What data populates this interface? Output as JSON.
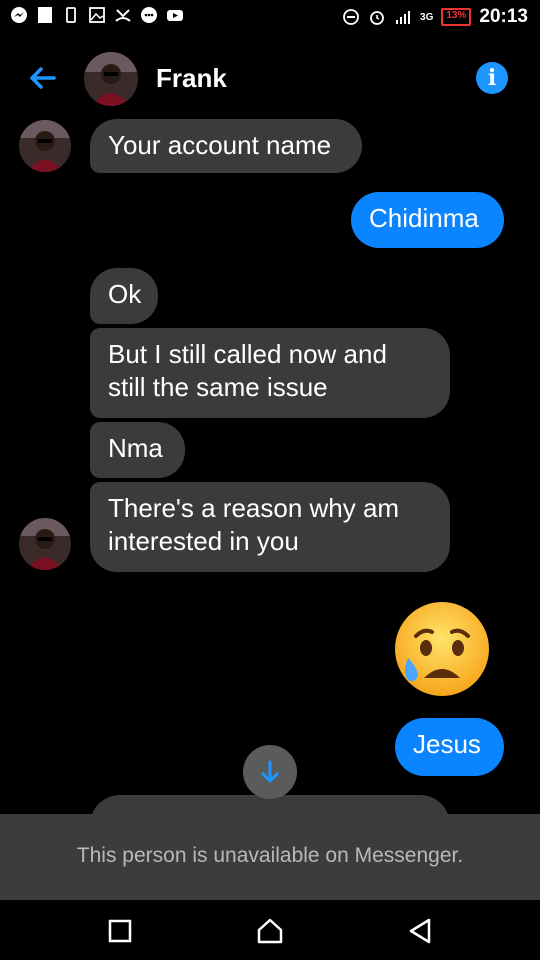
{
  "status_bar": {
    "time": "20:13",
    "battery": "13%",
    "network": "3G"
  },
  "header": {
    "name": "Frank",
    "info_icon": "i"
  },
  "messages": [
    {
      "sender": "Frank",
      "text": "Your account name"
    },
    {
      "sender": "me",
      "text": "Chidinma"
    },
    {
      "sender": "Frank",
      "text": "Ok"
    },
    {
      "sender": "Frank",
      "text": "But I still called now and\nstill the same issue"
    },
    {
      "sender": "Frank",
      "text": "Nma"
    },
    {
      "sender": "Frank",
      "text": "There's a reason why am\ninterested in you"
    },
    {
      "sender": "me",
      "emoji": "sad-but-relieved-face"
    },
    {
      "sender": "me",
      "text": "Jesus"
    }
  ],
  "footer": {
    "unavailable_text": "This person is unavailable on Messenger."
  },
  "colors": {
    "accent": "#0a84ff",
    "incoming_bubble": "#3a3b3c",
    "background": "#000000"
  }
}
